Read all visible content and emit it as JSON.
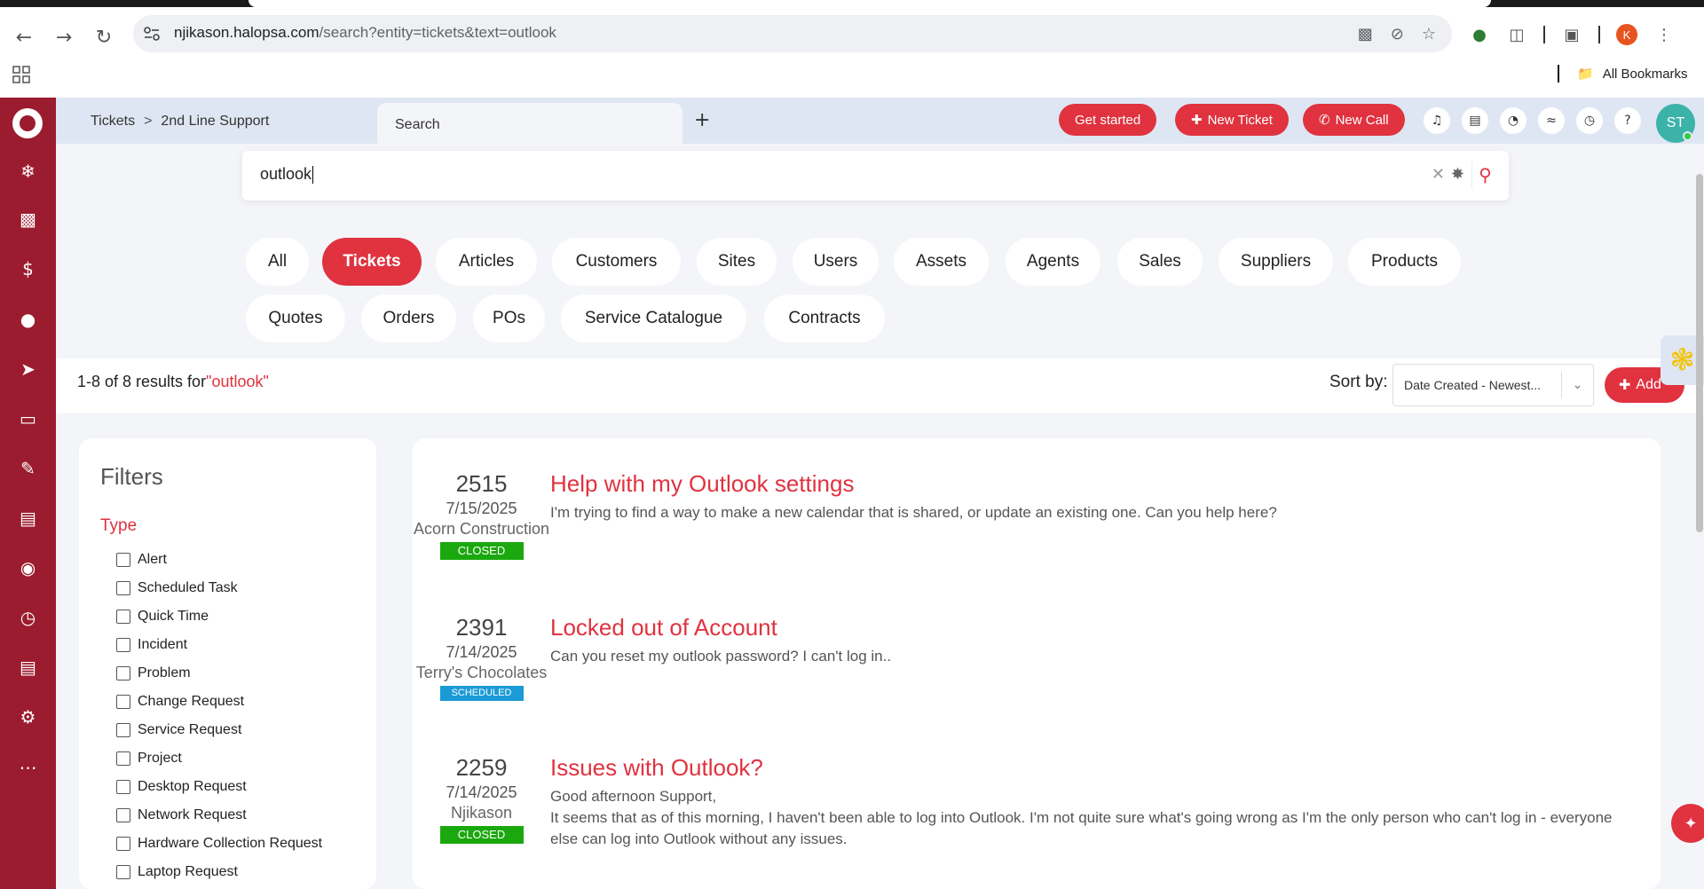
{
  "browser": {
    "url_host": "njikason.halopsa.com",
    "url_path": "/search?entity=tickets&text=outlook",
    "profile_initial": "K",
    "bookmarks_label": "All Bookmarks"
  },
  "header": {
    "breadcrumb": [
      "Tickets",
      "2nd Line Support"
    ],
    "tab_label": "Search",
    "get_started": "Get started",
    "new_ticket": "New Ticket",
    "new_call": "New Call",
    "avatar_initials": "ST"
  },
  "search": {
    "value": "outlook"
  },
  "chips": {
    "row1": [
      "All",
      "Tickets",
      "Articles",
      "Customers",
      "Sites",
      "Users",
      "Assets",
      "Agents",
      "Sales",
      "Suppliers",
      "Products"
    ],
    "row2": [
      "Quotes",
      "Orders",
      "POs",
      "Service Catalogue",
      "Contracts"
    ],
    "active": "Tickets"
  },
  "results_bar": {
    "count_text": "1-8 of 8 results for",
    "query_text": "\"outlook\"",
    "sort_label": "Sort by:",
    "sort_value": "Date Created - Newest...",
    "add_label": "Add"
  },
  "filters": {
    "title": "Filters",
    "section": "Type",
    "options": [
      "Alert",
      "Scheduled Task",
      "Quick Time",
      "Incident",
      "Problem",
      "Change Request",
      "Service Request",
      "Project",
      "Desktop Request",
      "Network Request",
      "Hardware Collection Request",
      "Laptop Request"
    ]
  },
  "tickets": [
    {
      "id": "2515",
      "date": "7/15/2025",
      "customer": "Acorn Construction",
      "status": "CLOSED",
      "title": "Help with my Outlook settings",
      "description": "I'm trying to find a way to make a new calendar that is shared, or update an existing one. Can you help here?"
    },
    {
      "id": "2391",
      "date": "7/14/2025",
      "customer": "Terry's Chocolates",
      "status": "SCHEDULED",
      "title": "Locked out of Account",
      "description": "Can you reset my outlook password? I can't log in.."
    },
    {
      "id": "2259",
      "date": "7/14/2025",
      "customer": "Njikason",
      "status": "CLOSED",
      "title": "Issues with Outlook?",
      "description": "Good afternoon Support,\nIt seems that as of this morning, I haven't been able to log into Outlook. I'm not quite sure what's going wrong as I'm the only person who can't log in - everyone else can log into Outlook without any issues."
    }
  ]
}
